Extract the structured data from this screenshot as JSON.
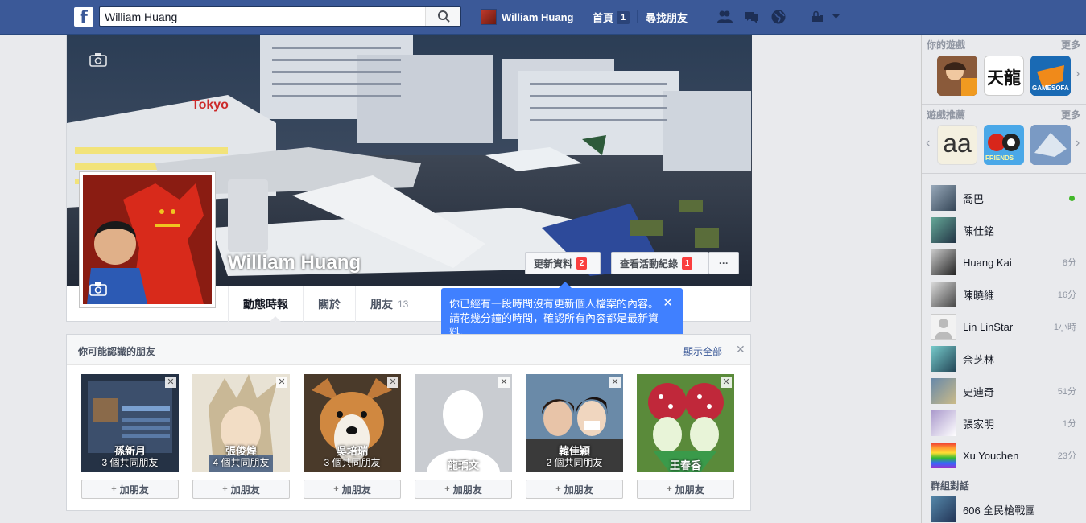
{
  "topbar": {
    "search_value": "William Huang",
    "user_name": "William Huang",
    "home_label": "首頁",
    "home_count": "1",
    "find_friends": "尋找朋友"
  },
  "profile": {
    "name": "William Huang",
    "update_info": "更新資料",
    "update_badge": "2",
    "activity_log": "查看活動紀錄",
    "activity_badge": "1",
    "more": "···",
    "tabs": [
      {
        "label": "動態時報",
        "count": ""
      },
      {
        "label": "關於",
        "count": ""
      },
      {
        "label": "朋友",
        "count": "13"
      }
    ]
  },
  "tooltip": {
    "text": "你已經有一段時間沒有更新個人檔案的內容。請花幾分鐘的時間，確認所有內容都是最新資料。",
    "close": "✕"
  },
  "pymk": {
    "title": "你可能認識的朋友",
    "see_all": "顯示全部",
    "add_label": "加朋友",
    "people": [
      {
        "name": "孫新月",
        "mutual": "3 個共同朋友"
      },
      {
        "name": "張俊煌",
        "mutual": "4 個共同朋友"
      },
      {
        "name": "吳培瑞",
        "mutual": "3 個共同朋友"
      },
      {
        "name": "龍瑀文",
        "mutual": ""
      },
      {
        "name": "韓佳穎",
        "mutual": "2 個共同朋友"
      },
      {
        "name": "王春香",
        "mutual": ""
      }
    ]
  },
  "sidebar": {
    "games_title": "你的遊戲",
    "games_more": "更多",
    "rec_title": "遊戲推薦",
    "rec_more": "更多",
    "game_labels": [
      "天龍",
      "GAMESOFA",
      "aa",
      "FRIENDS"
    ],
    "friends": [
      {
        "name": "喬巴",
        "time": "",
        "online": true
      },
      {
        "name": "陳仕銘",
        "time": ""
      },
      {
        "name": "Huang Kai",
        "time": "8分"
      },
      {
        "name": "陳曉維",
        "time": "16分"
      },
      {
        "name": "Lin LinStar",
        "time": "1小時"
      },
      {
        "name": "余芝林",
        "time": ""
      },
      {
        "name": "史迪奇",
        "time": "51分"
      },
      {
        "name": "張家明",
        "time": "1分"
      },
      {
        "name": "Xu Youchen",
        "time": "23分"
      }
    ],
    "groups_title": "群組對話",
    "groups": [
      {
        "name": "606 全民槍戰團"
      }
    ]
  }
}
